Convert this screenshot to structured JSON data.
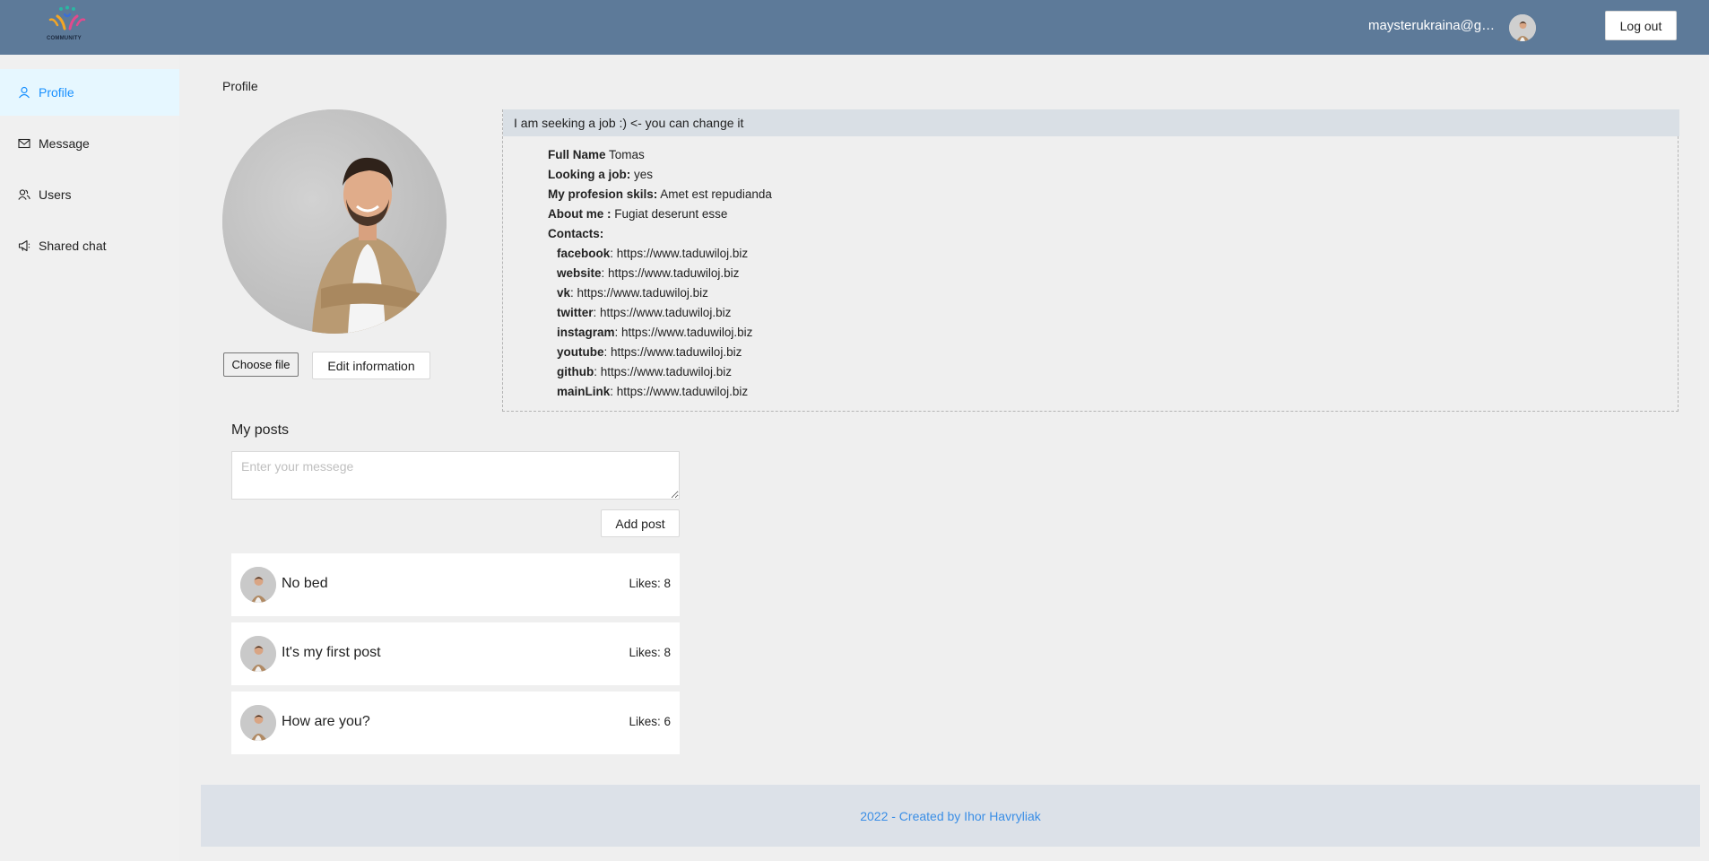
{
  "header": {
    "logo_text": "COMMUNITY",
    "user_email": "maysterukraina@gmail.com",
    "logout_label": "Log out"
  },
  "sidebar": {
    "items": [
      {
        "label": "Profile",
        "icon": "user-icon",
        "active": true
      },
      {
        "label": "Message",
        "icon": "mail-icon",
        "active": false
      },
      {
        "label": "Users",
        "icon": "users-icon",
        "active": false
      },
      {
        "label": "Shared chat",
        "icon": "sound-icon",
        "active": false
      }
    ]
  },
  "profile": {
    "page_title": "Profile",
    "status": "I  am seeking a job :) <- you can change it",
    "choose_file_label": "Choose file",
    "edit_label": "Edit information",
    "fields": {
      "full_name_label": "Full Name",
      "full_name": "Tomas",
      "looking_job_label": "Looking a job:",
      "looking_job": "yes",
      "skills_label": "My profesion skils:",
      "skills": "Amet est repudianda",
      "about_label": "About me :",
      "about": "Fugiat deserunt esse",
      "contacts_label": "Contacts:"
    },
    "contacts": [
      {
        "label": "facebook",
        "value": "https://www.taduwiloj.biz"
      },
      {
        "label": "website",
        "value": "https://www.taduwiloj.biz"
      },
      {
        "label": "vk",
        "value": "https://www.taduwiloj.biz"
      },
      {
        "label": "twitter",
        "value": "https://www.taduwiloj.biz"
      },
      {
        "label": "instagram",
        "value": "https://www.taduwiloj.biz"
      },
      {
        "label": "youtube",
        "value": "https://www.taduwiloj.biz"
      },
      {
        "label": "github",
        "value": "https://www.taduwiloj.biz"
      },
      {
        "label": "mainLink",
        "value": "https://www.taduwiloj.biz"
      }
    ]
  },
  "posts": {
    "title": "My posts",
    "input_placeholder": "Enter your messege",
    "add_label": "Add post",
    "items": [
      {
        "text": "No bed",
        "likes": "Likes: 8"
      },
      {
        "text": "It's my first post",
        "likes": "Likes: 8"
      },
      {
        "text": "How are you?",
        "likes": "Likes: 6"
      }
    ]
  },
  "footer": {
    "text": "2022 - Created by Ihor Havryliak"
  },
  "colors": {
    "header_bg": "#5d7a99",
    "accent": "#1890ff",
    "footer_text": "#3a8ee6"
  }
}
